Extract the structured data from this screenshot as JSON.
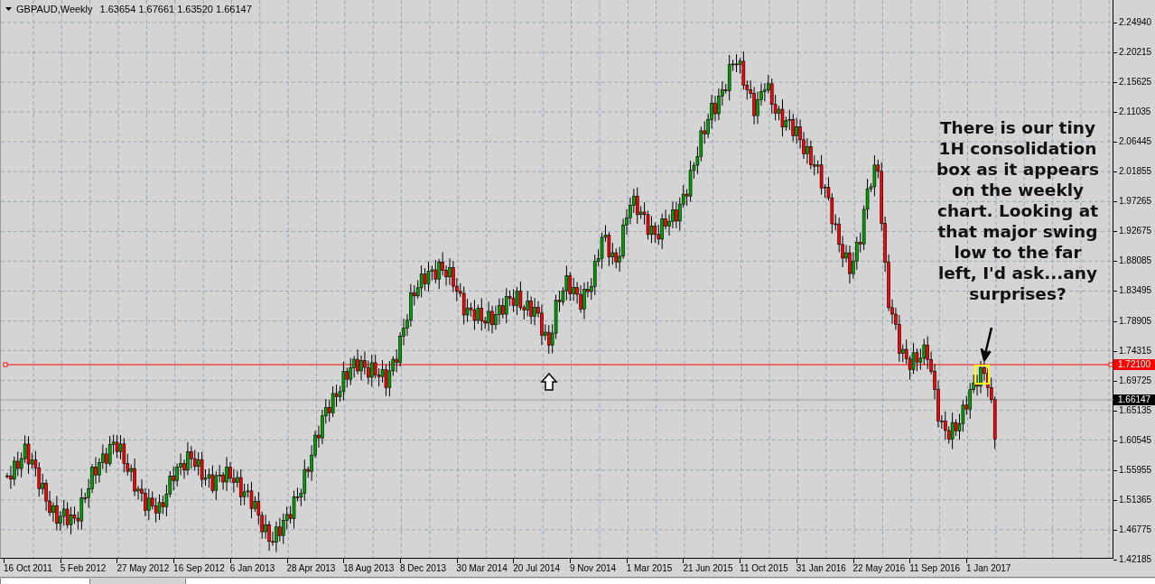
{
  "chart_header": {
    "symbol": "GBPAUD,Weekly",
    "ohlc": [
      "1.63654",
      "1.67661",
      "1.63520",
      "1.66147"
    ]
  },
  "price_axis": {
    "ticks": [
      "2.24940",
      "2.20215",
      "2.15625",
      "2.11035",
      "2.06445",
      "2.01855",
      "1.97265",
      "1.92675",
      "1.88085",
      "1.83495",
      "1.78905",
      "1.74315",
      "1.69725",
      "1.65135",
      "1.60545",
      "1.55955",
      "1.51365",
      "1.46775",
      "1.42185"
    ],
    "markers": [
      {
        "kind": "level-line",
        "label": "1.72100"
      },
      {
        "kind": "bid",
        "label": "1.66147"
      }
    ]
  },
  "time_axis": {
    "labels": [
      "16 Oct 2011",
      "5 Feb 2012",
      "27 May 2012",
      "16 Sep 2012",
      "6 Jan 2013",
      "28 Apr 2013",
      "18 Aug 2013",
      "8 Dec 2013",
      "30 Mar 2014",
      "20 Jul 2014",
      "9 Nov 2014",
      "1 Mar 2015",
      "21 Jun 2015",
      "11 Oct 2015",
      "31 Jan 2016",
      "22 May 2016",
      "11 Sep 2016",
      "1 Jan 2017"
    ]
  },
  "annotation": {
    "lines": [
      "There is our tiny",
      "1H consolidation",
      "box as it appears",
      "on the weekly",
      "chart. Looking at",
      "that major swing",
      "low to the far",
      "left, I'd ask...any",
      "surprises?"
    ]
  }
}
